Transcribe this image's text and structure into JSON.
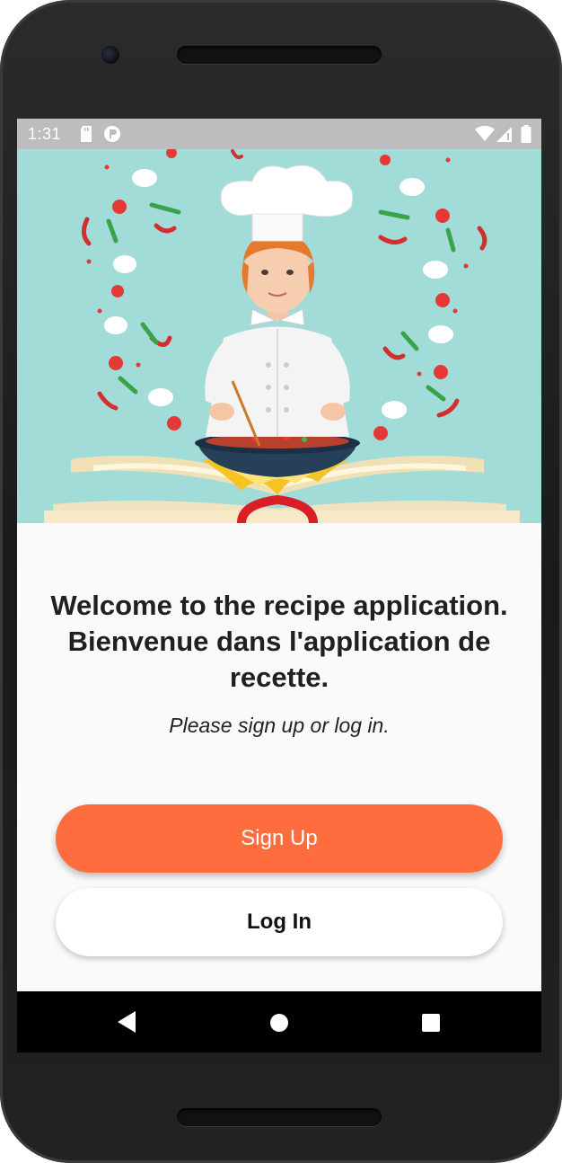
{
  "status_bar": {
    "time": "1:31",
    "icons": [
      "sd-card-icon",
      "data-saver-icon",
      "wifi-icon",
      "signal-icon",
      "battery-icon"
    ]
  },
  "hero": {
    "illustration": "chef-cooking-illustration",
    "background_color": "#a2dcd9"
  },
  "welcome": {
    "title_line1": "Welcome to the recipe application.",
    "title_line2": "Bienvenue dans l'application de",
    "title_line3": "recette.",
    "subtitle": "Please sign up or log in."
  },
  "actions": {
    "signup_label": "Sign Up",
    "login_label": "Log In",
    "signup_color": "#ff6d3f"
  },
  "nav_bar": {
    "icons": [
      "back-icon",
      "home-icon",
      "recents-icon"
    ]
  }
}
